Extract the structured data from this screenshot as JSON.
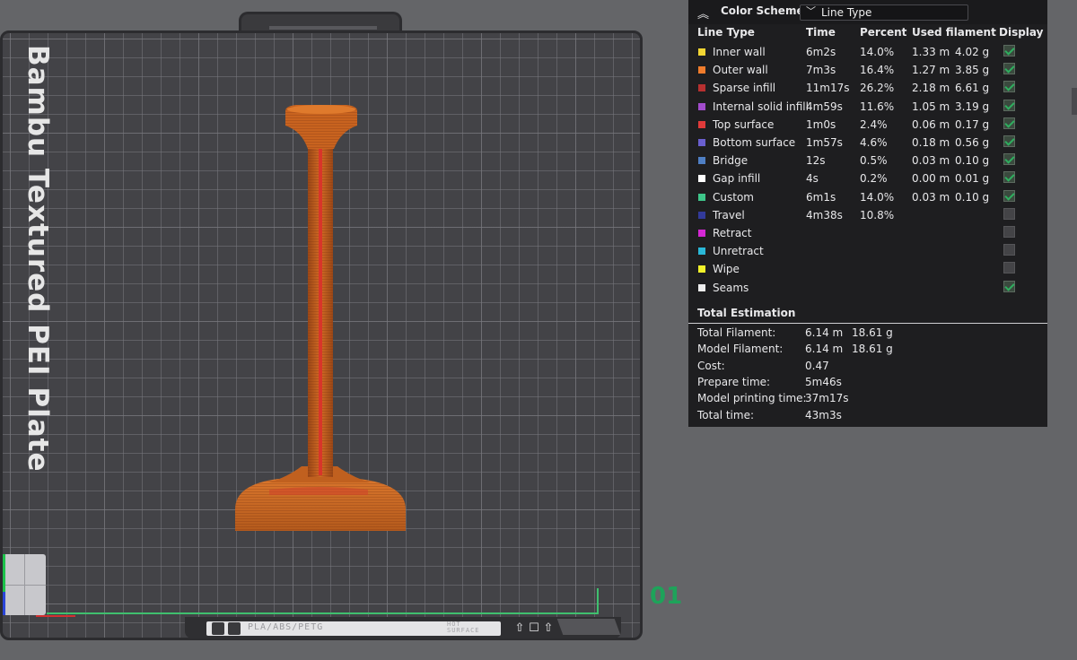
{
  "plate": {
    "label": "Bambu Textured PEI Plate",
    "number": "01",
    "filament_types": "PLA/ABS/PETG",
    "surface_text": "HOT SURFACE"
  },
  "color_scheme": {
    "title": "Color Scheme",
    "selected": "Line Type"
  },
  "legend": {
    "columns": [
      "Line Type",
      "Time",
      "Percent",
      "Used filament",
      "Display"
    ],
    "rows": [
      {
        "name": "Inner wall",
        "color": "#f2d533",
        "time": "6m2s",
        "percent": "14.0%",
        "length": "1.33 m",
        "weight": "4.02 g",
        "display": true
      },
      {
        "name": "Outer wall",
        "color": "#f07c2c",
        "time": "7m3s",
        "percent": "16.4%",
        "length": "1.27 m",
        "weight": "3.85 g",
        "display": true
      },
      {
        "name": "Sparse infill",
        "color": "#b73030",
        "time": "11m17s",
        "percent": "26.2%",
        "length": "2.18 m",
        "weight": "6.61 g",
        "display": true
      },
      {
        "name": "Internal solid infill",
        "color": "#a24ccc",
        "time": "4m59s",
        "percent": "11.6%",
        "length": "1.05 m",
        "weight": "3.19 g",
        "display": true
      },
      {
        "name": "Top surface",
        "color": "#e03a3a",
        "time": "1m0s",
        "percent": "2.4%",
        "length": "0.06 m",
        "weight": "0.17 g",
        "display": true
      },
      {
        "name": "Bottom surface",
        "color": "#6a5fcf",
        "time": "1m57s",
        "percent": "4.6%",
        "length": "0.18 m",
        "weight": "0.56 g",
        "display": true
      },
      {
        "name": "Bridge",
        "color": "#4f7fc4",
        "time": "12s",
        "percent": "0.5%",
        "length": "0.03 m",
        "weight": "0.10 g",
        "display": true
      },
      {
        "name": "Gap infill",
        "color": "#ffffff",
        "time": "4s",
        "percent": "0.2%",
        "length": "0.00 m",
        "weight": "0.01 g",
        "display": true
      },
      {
        "name": "Custom",
        "color": "#3ec68a",
        "time": "6m1s",
        "percent": "14.0%",
        "length": "0.03 m",
        "weight": "0.10 g",
        "display": true
      },
      {
        "name": "Travel",
        "color": "#323a9a",
        "time": "4m38s",
        "percent": "10.8%",
        "length": "",
        "weight": "",
        "display": false
      },
      {
        "name": "Retract",
        "color": "#d427d4",
        "time": "",
        "percent": "",
        "length": "",
        "weight": "",
        "display": false
      },
      {
        "name": "Unretract",
        "color": "#2ab8d8",
        "time": "",
        "percent": "",
        "length": "",
        "weight": "",
        "display": false
      },
      {
        "name": "Wipe",
        "color": "#f2f22a",
        "time": "",
        "percent": "",
        "length": "",
        "weight": "",
        "display": false
      },
      {
        "name": "Seams",
        "color": "#eeeeee",
        "time": "",
        "percent": "",
        "length": "",
        "weight": "",
        "display": true
      }
    ]
  },
  "total_estimation": {
    "title": "Total Estimation",
    "rows": [
      {
        "label": "Total Filament:",
        "v1": "6.14 m",
        "v2": "18.61 g"
      },
      {
        "label": "Model Filament:",
        "v1": "6.14 m",
        "v2": "18.61 g"
      },
      {
        "label": "Cost:",
        "v1": "0.47",
        "v2": ""
      },
      {
        "label": "Prepare time:",
        "v1": "5m46s",
        "v2": ""
      },
      {
        "label": "Model printing time:",
        "v1": "37m17s",
        "v2": ""
      },
      {
        "label": "Total time:",
        "v1": "43m3s",
        "v2": ""
      }
    ]
  },
  "model_colors": {
    "primary": "#c8631f",
    "light": "#df7a2c",
    "dark": "#8e3e12",
    "infill": "#d23a2a"
  }
}
